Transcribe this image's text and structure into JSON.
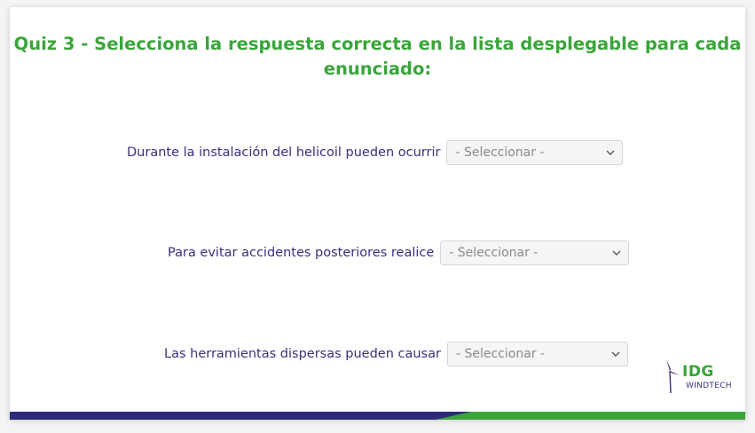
{
  "quiz": {
    "title_line1": "Quiz 3 - Selecciona la respuesta correcta en la lista desplegable para cada",
    "title_line2": "enunciado:"
  },
  "questions": [
    {
      "label": "Durante la instalación del helicoil pueden ocurrir",
      "selected": "- Seleccionar -"
    },
    {
      "label": "Para evitar accidentes posteriores realice",
      "selected": "- Seleccionar -"
    },
    {
      "label": "Las herramientas dispersas pueden causar",
      "selected": "- Seleccionar -"
    }
  ],
  "logo": {
    "brand": "IDG",
    "sub": "WINDTECH",
    "icon": "wind-turbine-icon"
  },
  "colors": {
    "title": "#3aa53a",
    "label": "#3b2f7e",
    "footer_purple": "#2e2a7a",
    "footer_green": "#3aa53a"
  }
}
